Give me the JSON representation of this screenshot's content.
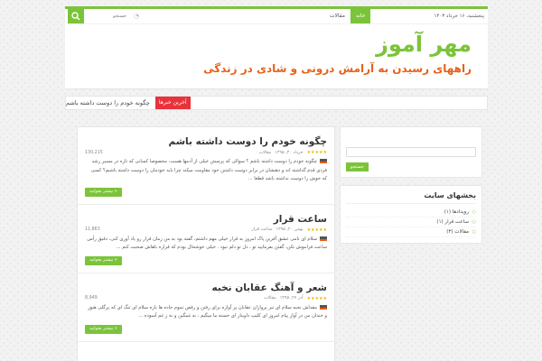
{
  "topbar": {
    "date": "پنجشنبه، ۱۶ خرداد ۱۴۰۳",
    "nav": [
      "خانه",
      "مقالات"
    ],
    "search_placeholder": "جستجو"
  },
  "header": {
    "title": "مهر آموز",
    "description": "راههای رسیدن به آرامش درونی و شادی در زندگی"
  },
  "ticker": {
    "label": "آخرین خبرها",
    "text": "چگونه خودم را دوست داشته باشم"
  },
  "posts": [
    {
      "title": "چگونه خودم را دوست داشته باشم",
      "date": "خرداد ۳۰, ۱۳۹۵",
      "category": "مقالات",
      "views": "130,215",
      "excerpt": "چگونه خودم را دوست داشته باشم ؟ سوالی که پرسش خیلی از آدمها هست، مخصوصا کسانی که تازه در مسیر رشد فردی قدم گذاشته اند و ذهنشان در برابر دوست داشتن خود مقاومت میکند چرا باید خودمان را دوست داشته باشیم؟ کسی که خوش را دوست نداشته باشد قطعا ...",
      "more": "بیشتر بخوانید »"
    },
    {
      "title": "ساعت قرار",
      "date": "بهمن ۲۰, ۱۳۹۵",
      "category": "ساعت قرار",
      "views": "11,863",
      "excerpt": "سلام ای نامی عشق آفرین پاک امروز به قرار خیلی مهم داشتم، گفته بود به من زمان قرار رو یاد آوری کنی، دقیق رأس ساعت فراموش نکن، گفتن بفرمایید تو ، دل تو دلم نبود . خیلی خوشحال بودم که قراره باهاش صحبت کنم ...",
      "more": "بیشتر بخوانید »"
    },
    {
      "title": "شعر و آهنگ عقابان نخبه",
      "date": "آذر ۲۷, ۱۳۹۵",
      "category": "مقالات",
      "views": "8,949",
      "excerpt": "مقداش نخبه سلام ای تیز پروازان عقابان پر آوازه برای رفتن و رقص تموم جاده ها باره سلام ای تنگ ای که پرگلی هنوز و خندان من در آواز پیام امروز ای کلیپ داوینار ای خسته ما میگیم ، نه غمگین و نه ز غم آسوده ...",
      "more": "بیشتر بخوانید »"
    }
  ],
  "sidebar": {
    "search_button": "جستجو",
    "sections_title": "بخشهای سایت",
    "categories": [
      "رویدادها (۱)",
      "ساعت قرار (۱)",
      "مقالات (۳)"
    ]
  },
  "colors": {
    "accent": "#7bc43a",
    "orange": "#e8601a",
    "red": "#e8333a"
  }
}
